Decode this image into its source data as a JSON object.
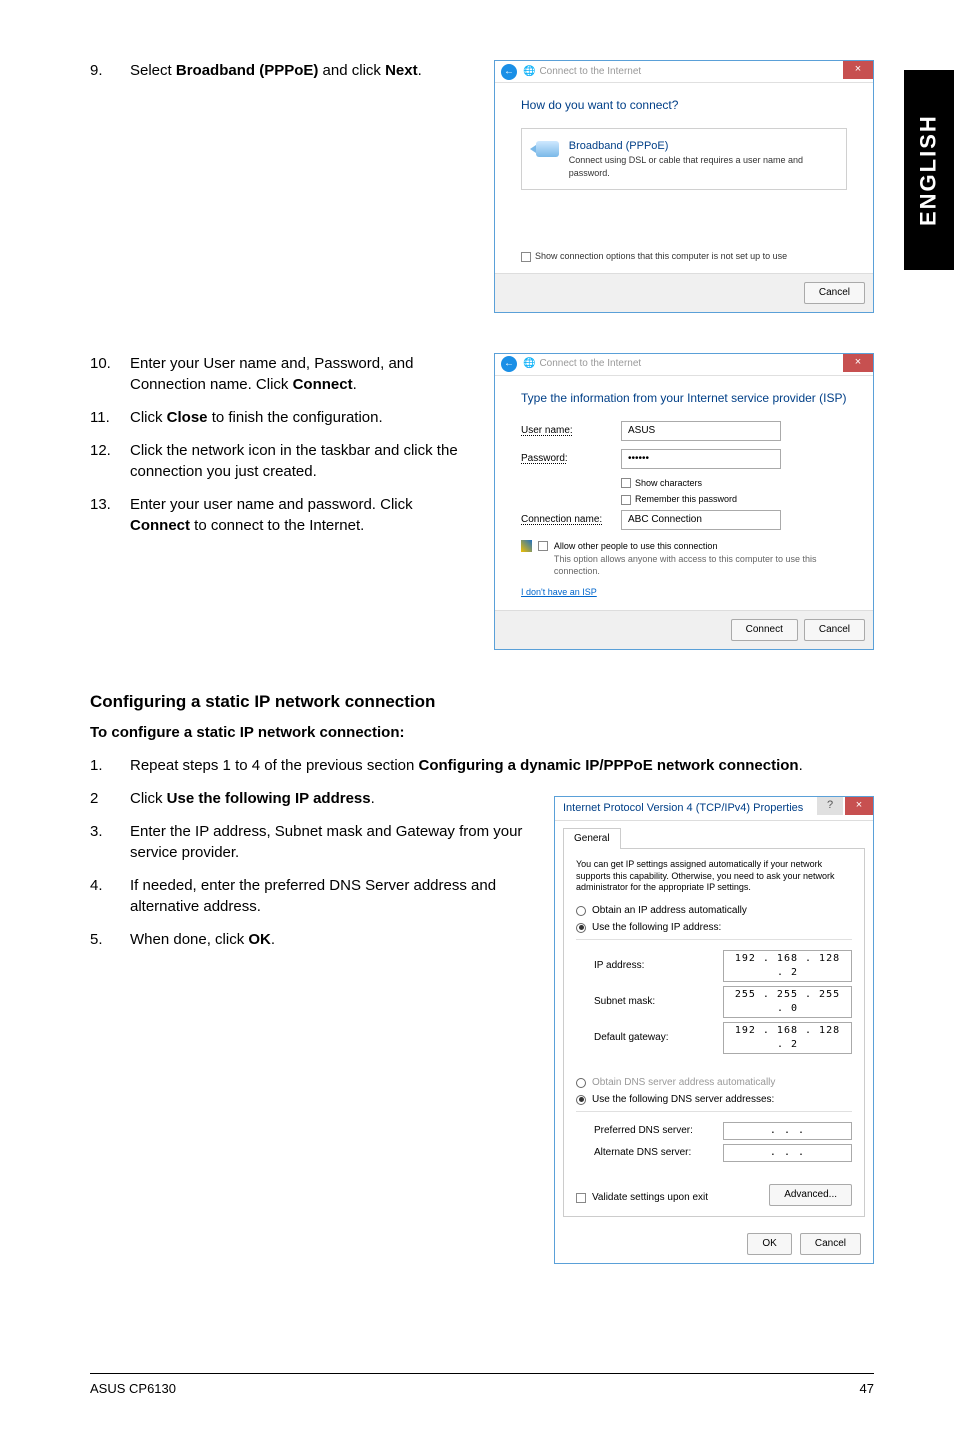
{
  "sideTab": "ENGLISH",
  "step9": {
    "num": "9.",
    "prefix": "Select ",
    "bold1": "Broadband (PPPoE)",
    "mid": " and click ",
    "bold2": "Next",
    "suffix": "."
  },
  "dialog1": {
    "titlebarText": "Connect to the Internet",
    "heading": "How do you want to connect?",
    "bbTitle": "Broadband (PPPoE)",
    "bbDesc": "Connect using DSL or cable that requires a user name and password.",
    "showOpts": "Show connection options that this computer is not set up to use",
    "cancel": "Cancel"
  },
  "step10": {
    "num": "10.",
    "t1": "Enter your User name and, Password, and Connection name. Click ",
    "b": "Connect",
    "t2": "."
  },
  "step11": {
    "num": "11.",
    "t1": "Click ",
    "b": "Close",
    "t2": " to finish the configuration."
  },
  "step12": {
    "num": "12.",
    "t": "Click the network icon in the taskbar and click the connection you just created."
  },
  "step13": {
    "num": "13.",
    "t1": "Enter your user name and password. Click ",
    "b": "Connect",
    "t2": " to connect to the Internet."
  },
  "dialog2": {
    "titlebarText": "Connect to the Internet",
    "heading": "Type the information from your Internet service provider (ISP)",
    "userLabel": "User name:",
    "userVal": "ASUS",
    "passLabel": "Password:",
    "passVal": "••••••",
    "showChars": "Show characters",
    "remember": "Remember this password",
    "connNameLabel": "Connection name:",
    "connNameVal": "ABC Connection",
    "allowLabel": "Allow other people to use this connection",
    "allowDesc": "This option allows anyone with access to this computer to use this connection.",
    "noIsp": "I don't have an ISP",
    "connect": "Connect",
    "cancel": "Cancel"
  },
  "staticHeading": "Configuring a static IP network connection",
  "staticSub": "To configure a static IP network connection:",
  "s1": {
    "num": "1.",
    "t1": "Repeat steps 1 to 4 of the previous section ",
    "b": "Configuring a dynamic IP/PPPoE network connection",
    "t2": "."
  },
  "s2": {
    "num": "2",
    "t1": "Click ",
    "b": "Use the following IP address",
    "t2": "."
  },
  "s3": {
    "num": "3.",
    "t": "Enter the IP address, Subnet mask and Gateway from your service provider."
  },
  "s4": {
    "num": "4.",
    "t": "If needed, enter the preferred DNS Server address and alternative address."
  },
  "s5": {
    "num": "5.",
    "t1": "When done, click ",
    "b": "OK",
    "t2": "."
  },
  "ipv4": {
    "title": "Internet Protocol Version 4 (TCP/IPv4) Properties",
    "tab": "General",
    "desc": "You can get IP settings assigned automatically if your network supports this capability. Otherwise, you need to ask your network administrator for the appropriate IP settings.",
    "obtainAuto": "Obtain an IP address automatically",
    "useFollowing": "Use the following IP address:",
    "ipLabel": "IP address:",
    "ipVal": "192 . 168 . 128 .   2",
    "subnetLabel": "Subnet mask:",
    "subnetVal": "255 . 255 . 255 .   0",
    "gwLabel": "Default gateway:",
    "gwVal": "192 . 168 . 128 .   2",
    "obtainDnsAuto": "Obtain DNS server address automatically",
    "useDns": "Use the following DNS server addresses:",
    "prefDnsLabel": "Preferred DNS server:",
    "prefDnsVal": ".       .       .",
    "altDnsLabel": "Alternate DNS server:",
    "altDnsVal": ".       .       .",
    "validate": "Validate settings upon exit",
    "advanced": "Advanced...",
    "ok": "OK",
    "cancel": "Cancel"
  },
  "footer": {
    "left": "ASUS CP6130",
    "right": "47"
  }
}
